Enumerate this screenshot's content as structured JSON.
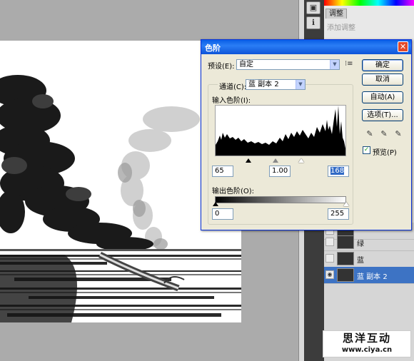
{
  "adjustments_panel": {
    "tab_label": "调整",
    "hint": "添加调整"
  },
  "layers": [
    {
      "name": "",
      "visible": false,
      "selected": false
    },
    {
      "name": "绿",
      "visible": false,
      "selected": false
    },
    {
      "name": "蓝",
      "visible": false,
      "selected": false
    },
    {
      "name": "蓝 副本 2",
      "visible": true,
      "selected": true
    }
  ],
  "watermark": {
    "title": "思洋互动",
    "url": "www.ciya.cn"
  },
  "levels_dialog": {
    "title": "色阶",
    "close_glyph": "✕",
    "preset_label": "预设(E):",
    "preset_value": "自定",
    "preset_menu_glyph": "⁝≡",
    "channel_label": "通道(C):",
    "channel_value": "蓝 副本 2",
    "input_levels_label": "输入色阶(I):",
    "input_black": "65",
    "input_gamma": "1.00",
    "input_white": "168",
    "output_levels_label": "输出色阶(O):",
    "output_black": "0",
    "output_white": "255",
    "buttons": {
      "ok": "确定",
      "cancel": "取消",
      "auto": "自动(A)",
      "options": "选项(T)..."
    },
    "preview_label": "预览(P)",
    "preview_checked": true,
    "eyedropper_glyph": "✎",
    "dropdown_glyph": "▼",
    "check_glyph": "✓",
    "eye_glyph": "◉"
  }
}
